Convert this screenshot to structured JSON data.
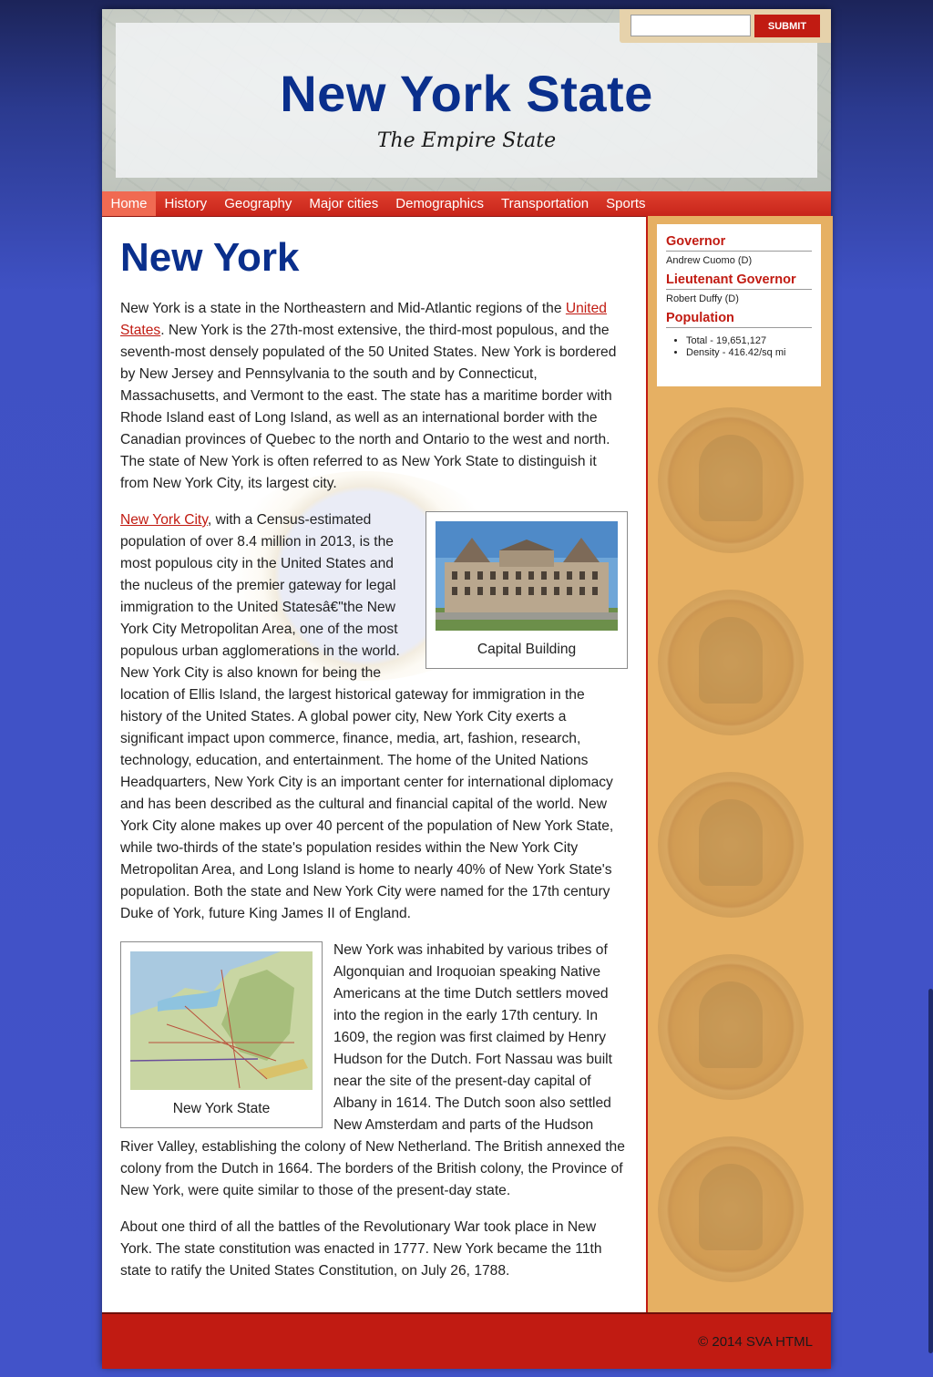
{
  "colors": {
    "brand_blue": "#0a2f8c",
    "accent_red": "#c11b12",
    "sidebar_tan": "#e6b063",
    "page_bg": "#4253c9"
  },
  "header": {
    "title": "New York State",
    "tagline": "The Empire State",
    "search": {
      "placeholder": "",
      "value": "",
      "submit_label": "SUBMIT"
    }
  },
  "nav": {
    "items": [
      {
        "label": "Home",
        "active": true
      },
      {
        "label": "History"
      },
      {
        "label": "Geography"
      },
      {
        "label": "Major cities"
      },
      {
        "label": "Demographics"
      },
      {
        "label": "Transportation"
      },
      {
        "label": "Sports"
      }
    ]
  },
  "main": {
    "heading": "New York",
    "p1": {
      "before": "New York is a state in the Northeastern and Mid-Atlantic regions of the ",
      "link": "United States",
      "after": ". New York is the 27th-most extensive, the third-most populous, and the seventh-most densely populated of the 50 United States. New York is bordered by New Jersey and Pennsylvania to the south and by Connecticut, Massachusetts, and Vermont to the east. The state has a maritime border with Rhode Island east of Long Island, as well as an international border with the Canadian provinces of Quebec to the north and Ontario to the west and north. The state of New York is often referred to as New York State to distinguish it from New York City, its largest city."
    },
    "figure1": {
      "caption": "Capital Building"
    },
    "p2": {
      "link": "New York City",
      "after": ", with a Census-estimated population of over 8.4 million in 2013, is the most populous city in the United States and the nucleus of the premier gateway for legal immigration to the United Statesâ€\"the New York City Metropolitan Area, one of the most populous urban agglomerations in the world. New York City is also known for being the location of Ellis Island, the largest historical gateway for immigration in the history of the United States. A global power city, New York City exerts a significant impact upon commerce, finance, media, art, fashion, research, technology, education, and entertainment. The home of the United Nations Headquarters, New York City is an important center for international diplomacy and has been described as the cultural and financial capital of the world. New York City alone makes up over 40 percent of the population of New York State, while two-thirds of the state's population resides within the New York City Metropolitan Area, and Long Island is home to nearly 40% of New York State's population. Both the state and New York City were named for the 17th century Duke of York, future King James II of England."
    },
    "figure2": {
      "caption": "New York State"
    },
    "p3": "New York was inhabited by various tribes of Algonquian and Iroquoian speaking Native Americans at the time Dutch settlers moved into the region in the early 17th century. In 1609, the region was first claimed by Henry Hudson for the Dutch. Fort Nassau was built near the site of the present-day capital of Albany in 1614. The Dutch soon also settled New Amsterdam and parts of the Hudson River Valley, establishing the colony of New Netherland. The British annexed the colony from the Dutch in 1664. The borders of the British colony, the Province of New York, were quite similar to those of the present-day state.",
    "p4": "About one third of all the battles of the Revolutionary War took place in New York. The state constitution was enacted in 1777. New York became the 11th state to ratify the United States Constitution, on July 26, 1788."
  },
  "sidebar": {
    "governor_heading": "Governor",
    "governor": "Andrew Cuomo (D)",
    "lt_governor_heading": "Lieutenant Governor",
    "lt_governor": "Robert Duffy (D)",
    "population_heading": "Population",
    "population_items": [
      "Total - 19,651,127",
      "Density - 416.42/sq mi"
    ]
  },
  "footer": {
    "text": "© 2014 SVA HTML"
  }
}
